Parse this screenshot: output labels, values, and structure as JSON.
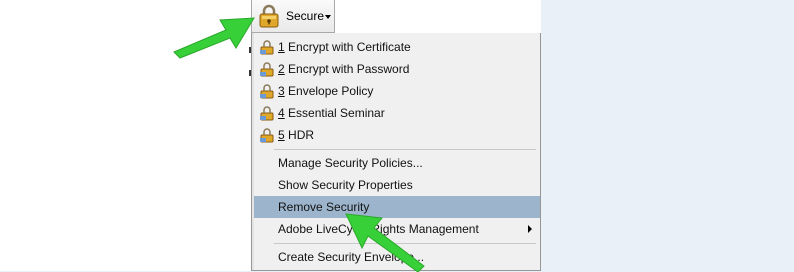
{
  "toolbar": {
    "secure_label": "Secure"
  },
  "menu": {
    "items": [
      {
        "num": "1",
        "label": " Encrypt with Certificate"
      },
      {
        "num": "2",
        "label": " Encrypt with Password"
      },
      {
        "num": "3",
        "label": " Envelope Policy"
      },
      {
        "num": "4",
        "label": " Essential Seminar"
      },
      {
        "num": "5",
        "label": " HDR"
      }
    ],
    "manage": "Manage Security Policies...",
    "show": "Show Security Properties",
    "remove": "Remove Security",
    "adobe": "Adobe LiveCycle Rights Management",
    "create": "Create Security Envelope..."
  },
  "colors": {
    "highlight": "#9db5cc",
    "arrow": "#38d038"
  },
  "icons": {
    "secure": "padlock-icon",
    "policy": "policy-icon",
    "submenu": "submenu-arrow-icon"
  }
}
